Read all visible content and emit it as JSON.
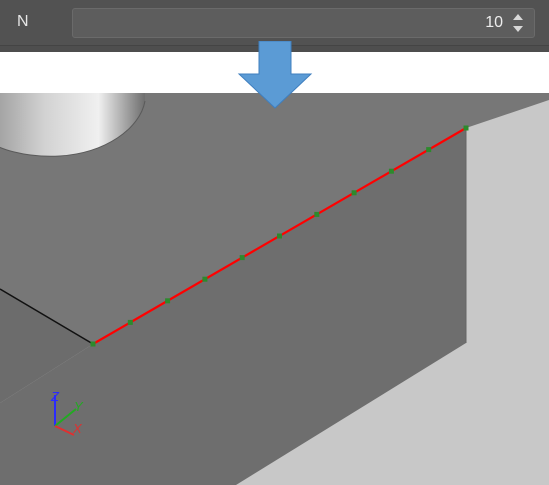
{
  "parameter": {
    "label": "N",
    "value": "10"
  },
  "axes": {
    "z_label": "Z",
    "y_label": "Y",
    "x_label": "X"
  },
  "colors": {
    "panel_bg": "#525252",
    "field_bg": "#5d5d5d",
    "viewport_bg": "#c8c8c8",
    "top_face": "#777777",
    "front_face": "#6a6a6a",
    "side_face": "#707070",
    "edge_highlight": "#ff0000",
    "division_points": "#2c8a2c",
    "arrow_fill": "#5b9bd5",
    "axis_z": "#2a2aff",
    "axis_y": "#22aa22",
    "axis_x": "#e03030"
  },
  "icons": {
    "spin_up": "chevron-up-icon",
    "spin_down": "chevron-down-icon",
    "arrow": "arrow-down-icon"
  },
  "edge_division_count": 10
}
